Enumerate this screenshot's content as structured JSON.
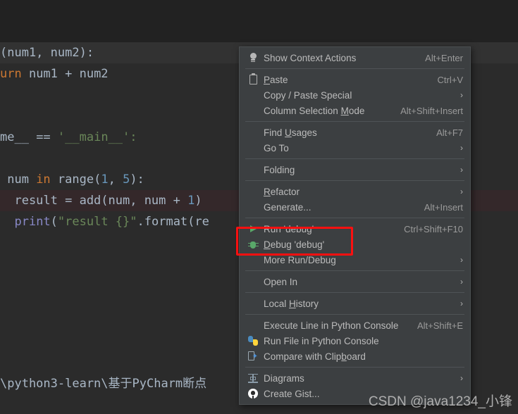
{
  "editor": {
    "lines": [
      {
        "id": "l1",
        "highlight": "none",
        "parts": [
          {
            "t": "(num1, num2):",
            "c": "plain"
          }
        ]
      },
      {
        "id": "l2",
        "highlight": "none",
        "parts": [
          {
            "t": "urn",
            "c": "kw"
          },
          {
            "t": " num1 + num2",
            "c": "plain"
          }
        ]
      },
      {
        "id": "l3",
        "highlight": "none",
        "parts": [
          {
            "t": "",
            "c": "plain"
          }
        ]
      },
      {
        "id": "l4",
        "highlight": "none",
        "parts": [
          {
            "t": "",
            "c": "plain"
          }
        ]
      },
      {
        "id": "l5",
        "highlight": "none",
        "parts": [
          {
            "t": "me__ ",
            "c": "plain"
          },
          {
            "t": "==",
            "c": "plain"
          },
          {
            "t": " '__main__':",
            "c": "str"
          }
        ]
      },
      {
        "id": "l6",
        "highlight": "none",
        "parts": [
          {
            "t": "",
            "c": "plain"
          }
        ]
      },
      {
        "id": "l7",
        "highlight": "none",
        "parts": [
          {
            "t": " num ",
            "c": "plain"
          },
          {
            "t": "in",
            "c": "kw"
          },
          {
            "t": " range(",
            "c": "plain"
          },
          {
            "t": "1",
            "c": "num"
          },
          {
            "t": ", ",
            "c": "plain"
          },
          {
            "t": "5",
            "c": "num"
          },
          {
            "t": "):",
            "c": "plain"
          }
        ]
      },
      {
        "id": "l8",
        "highlight": "breakpoint",
        "parts": [
          {
            "t": "  result = add(num, num + ",
            "c": "plain"
          },
          {
            "t": "1",
            "c": "num"
          },
          {
            "t": ")",
            "c": "plain"
          }
        ]
      },
      {
        "id": "l9",
        "highlight": "none",
        "parts": [
          {
            "t": "  ",
            "c": "plain"
          },
          {
            "t": "print",
            "c": "builtin"
          },
          {
            "t": "(",
            "c": "plain"
          },
          {
            "t": "\"result {}\"",
            "c": "str"
          },
          {
            "t": ".format(re",
            "c": "plain"
          }
        ]
      }
    ],
    "path_text": "\\python3-learn\\基于PyCharm断点"
  },
  "watermark": {
    "text": "CSDN @java1234_小锋"
  },
  "context_menu": {
    "groups": [
      {
        "items": [
          {
            "icon": "lightbulb-icon",
            "label": "Show Context Actions",
            "label_html": "Show Context Actions",
            "shortcut": "Alt+Enter",
            "submenu": false
          }
        ]
      },
      {
        "items": [
          {
            "icon": "clipboard-icon",
            "label": "Paste",
            "label_html": "<u>P</u>aste",
            "shortcut": "Ctrl+V",
            "submenu": false
          },
          {
            "icon": "none",
            "label": "Copy / Paste Special",
            "label_html": "Copy / Paste Special",
            "shortcut": "",
            "submenu": true
          },
          {
            "icon": "none",
            "label": "Column Selection Mode",
            "label_html": "Column Selection <u>M</u>ode",
            "shortcut": "Alt+Shift+Insert",
            "submenu": false
          }
        ]
      },
      {
        "items": [
          {
            "icon": "none",
            "label": "Find Usages",
            "label_html": "Find <u>U</u>sages",
            "shortcut": "Alt+F7",
            "submenu": false
          },
          {
            "icon": "none",
            "label": "Go To",
            "label_html": "Go To",
            "shortcut": "",
            "submenu": true
          }
        ]
      },
      {
        "items": [
          {
            "icon": "none",
            "label": "Folding",
            "label_html": "Folding",
            "shortcut": "",
            "submenu": true
          }
        ]
      },
      {
        "items": [
          {
            "icon": "none",
            "label": "Refactor",
            "label_html": "<u>R</u>efactor",
            "shortcut": "",
            "submenu": true
          },
          {
            "icon": "none",
            "label": "Generate...",
            "label_html": "Generate...",
            "shortcut": "Alt+Insert",
            "submenu": false
          }
        ]
      },
      {
        "items": [
          {
            "icon": "run-icon",
            "label": "Run 'debug'",
            "label_html": "Run 'debug'",
            "shortcut": "Ctrl+Shift+F10",
            "submenu": false
          },
          {
            "icon": "debug-icon",
            "label": "Debug 'debug'",
            "label_html": "<u>D</u>ebug 'debug'",
            "shortcut": "",
            "submenu": false
          },
          {
            "icon": "none",
            "label": "More Run/Debug",
            "label_html": "More Run/Debug",
            "shortcut": "",
            "submenu": true
          }
        ]
      },
      {
        "items": [
          {
            "icon": "none",
            "label": "Open In",
            "label_html": "Open In",
            "shortcut": "",
            "submenu": true
          }
        ]
      },
      {
        "items": [
          {
            "icon": "none",
            "label": "Local History",
            "label_html": "Local <u>H</u>istory",
            "shortcut": "",
            "submenu": true
          }
        ]
      },
      {
        "items": [
          {
            "icon": "none",
            "label": "Execute Line in Python Console",
            "label_html": "Execute Line in Python Console",
            "shortcut": "Alt+Shift+E",
            "submenu": false
          },
          {
            "icon": "python-icon",
            "label": "Run File in Python Console",
            "label_html": "Run File in Python Console",
            "shortcut": "",
            "submenu": false
          },
          {
            "icon": "compare-clipboard-icon",
            "label": "Compare with Clipboard",
            "label_html": "Compare with Clip<u>b</u>oard",
            "shortcut": "",
            "submenu": false
          }
        ]
      },
      {
        "items": [
          {
            "icon": "diagram-icon",
            "label": "Diagrams",
            "label_html": "Diagrams",
            "shortcut": "",
            "submenu": true
          },
          {
            "icon": "github-icon",
            "label": "Create Gist...",
            "label_html": "Create Gist...",
            "shortcut": "",
            "submenu": false
          }
        ]
      }
    ]
  },
  "annotation": {
    "type": "red-rectangle",
    "color": "#fb1010",
    "targets": "Debug 'debug'"
  },
  "colors": {
    "editor_bg": "#2b2b2b",
    "top_band": "#222222",
    "menu_bg": "#3c3f41",
    "menu_text": "#bbbbbb",
    "breakpoint_line": "#34282a",
    "keyword": "#cc7832",
    "string": "#6a8759",
    "number": "#6897bb",
    "builtin": "#8888c6",
    "accent_green": "#59a869"
  }
}
